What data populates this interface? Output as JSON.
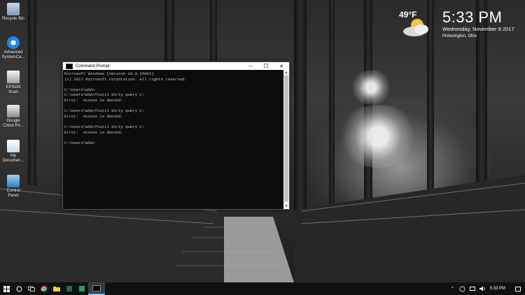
{
  "desktop": {
    "icons": [
      {
        "label": "Recycle Bin",
        "icon": "recycle-bin-icon",
        "color": "#9ab6d4"
      },
      {
        "label": "Advanced SystemCa...",
        "icon": "advanced-systemcare-icon",
        "color": "#1e88e5"
      },
      {
        "label": "EPSON Scan",
        "icon": "epson-scan-icon",
        "color": "#e0e0e0"
      },
      {
        "label": "Google Cloud Pri...",
        "icon": "google-cloud-print-icon",
        "color": "#d0d0d0"
      },
      {
        "label": "My Documen...",
        "icon": "my-documents-icon",
        "color": "#f0f0f0"
      },
      {
        "label": "Control Panel",
        "icon": "control-panel-icon",
        "color": "#4aa3df"
      }
    ]
  },
  "weather": {
    "temperature": "49°F",
    "icon": "partly-cloudy-icon"
  },
  "clock": {
    "time": "5:33 PM",
    "date": "Wednesday, November 8 2017",
    "location": "Pickerington, Ohio"
  },
  "window": {
    "title": "Command Prompt",
    "minimize_glyph": "—",
    "maximize_glyph": "☐",
    "close_glyph": "✕",
    "console_lines": [
      "Microsoft Windows [Version 10.0.15063]",
      "(c) 2017 Microsoft Corporation. All rights reserved.",
      "",
      "C:\\Users\\WSA>",
      "C:\\Users\\WSA>fsutil dirty query C:",
      "Error:  Access is denied.",
      "",
      "C:\\Users\\WSA>fsutil dirty query C:",
      "Error:  Access is denied.",
      "",
      "C:\\Users\\WSA>fsutil dirty query C:",
      "Error:  Access is denied.",
      "",
      "C:\\Users\\WSA>"
    ]
  },
  "taskbar": {
    "items": [
      {
        "name": "start-button",
        "icon": "windows-logo-icon"
      },
      {
        "name": "cortana-button",
        "icon": "cortana-circle-icon"
      },
      {
        "name": "task-view-button",
        "icon": "task-view-icon"
      },
      {
        "name": "chrome-button",
        "icon": "chrome-icon"
      },
      {
        "name": "file-explorer-button",
        "icon": "folder-icon"
      },
      {
        "name": "excel-button",
        "icon": "excel-icon"
      },
      {
        "name": "green-app-button",
        "icon": "app-icon"
      },
      {
        "name": "command-prompt-button",
        "icon": "command-prompt-icon"
      }
    ],
    "tray_time": "5:33 PM",
    "accent_color": "#76b9ed"
  }
}
